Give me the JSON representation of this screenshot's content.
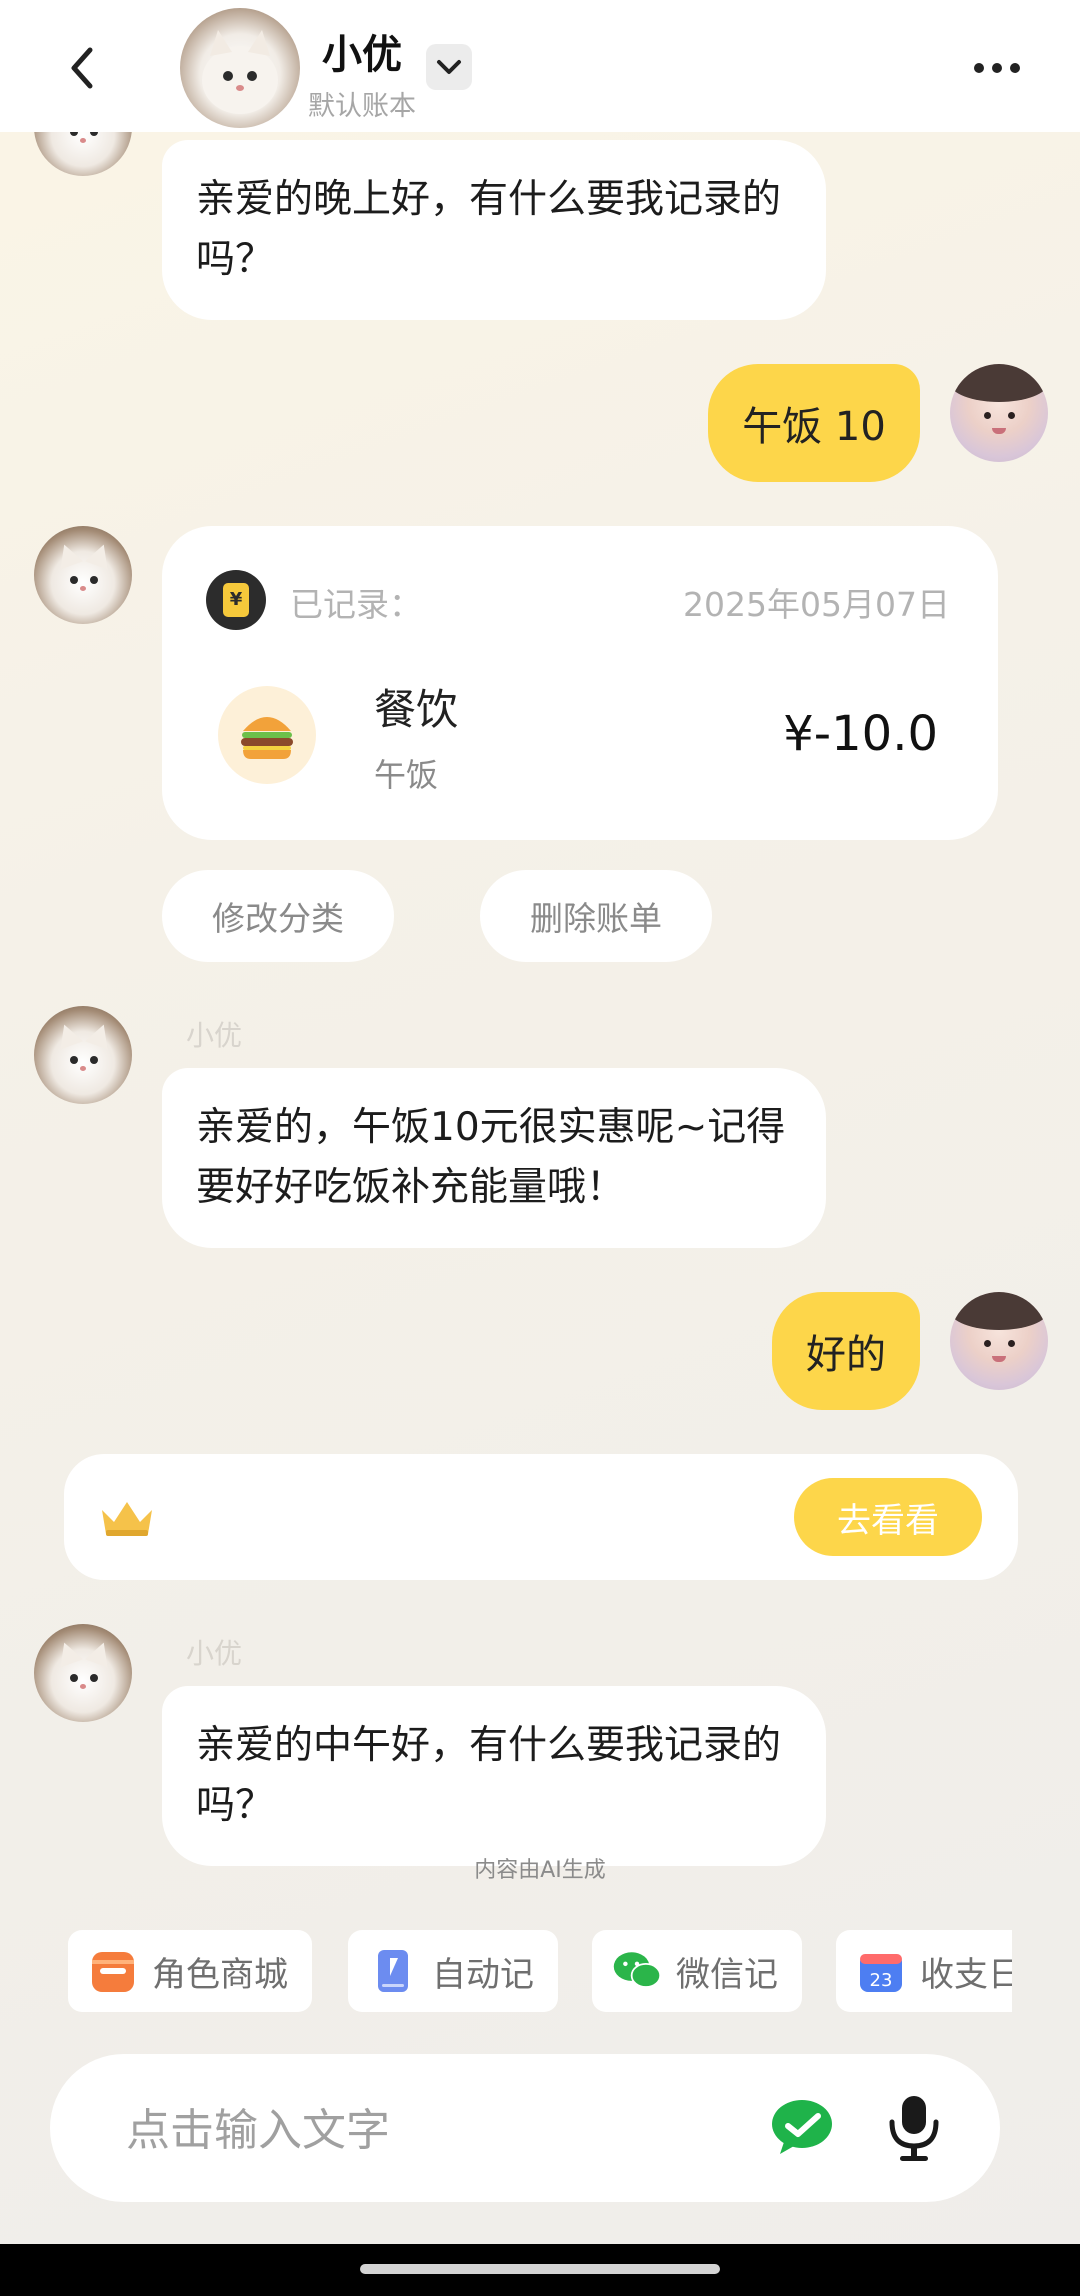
{
  "header": {
    "title": "小优",
    "subtitle": "默认账本",
    "icons": {
      "back": "chevron-left-icon",
      "dropdown": "chevron-down-icon",
      "more": "more-dots-icon"
    }
  },
  "messages": {
    "ai_greeting_evening": "亲爱的晚上好，有什么要我记录的吗？",
    "user_lunch": "午饭 10",
    "record": {
      "label": "已记录：",
      "date": "2025年05月07日",
      "category": "餐饮",
      "note": "午饭",
      "amount": "¥-10.0",
      "icon": "burger-icon"
    },
    "actions": {
      "edit_category": "修改分类",
      "delete_bill": "删除账单"
    },
    "sender_name_1": "小优",
    "ai_reply": "亲爱的，午饭10元很实惠呢~记得要好好吃饭补充能量哦！",
    "user_ok": "好的",
    "promo_button": "去看看",
    "sender_name_2": "小优",
    "ai_greeting_noon": "亲爱的中午好，有什么要我记录的吗？"
  },
  "ai_note": "内容由AI生成",
  "shortcuts": [
    {
      "label": "角色商城",
      "icon": "store-icon",
      "color": "#f57c3c"
    },
    {
      "label": "自动记",
      "icon": "book-icon",
      "color": "#6c8cf0"
    },
    {
      "label": "微信记",
      "icon": "wechat-icon",
      "color": "#2bb54a"
    },
    {
      "label": "收支日历",
      "icon": "calendar-icon",
      "color": "#4d7ef2"
    }
  ],
  "input": {
    "placeholder": "点击输入文字"
  },
  "colors": {
    "accent": "#fdd64a",
    "bubble_ai": "#ffffff",
    "text_muted": "#a6a6a6"
  }
}
